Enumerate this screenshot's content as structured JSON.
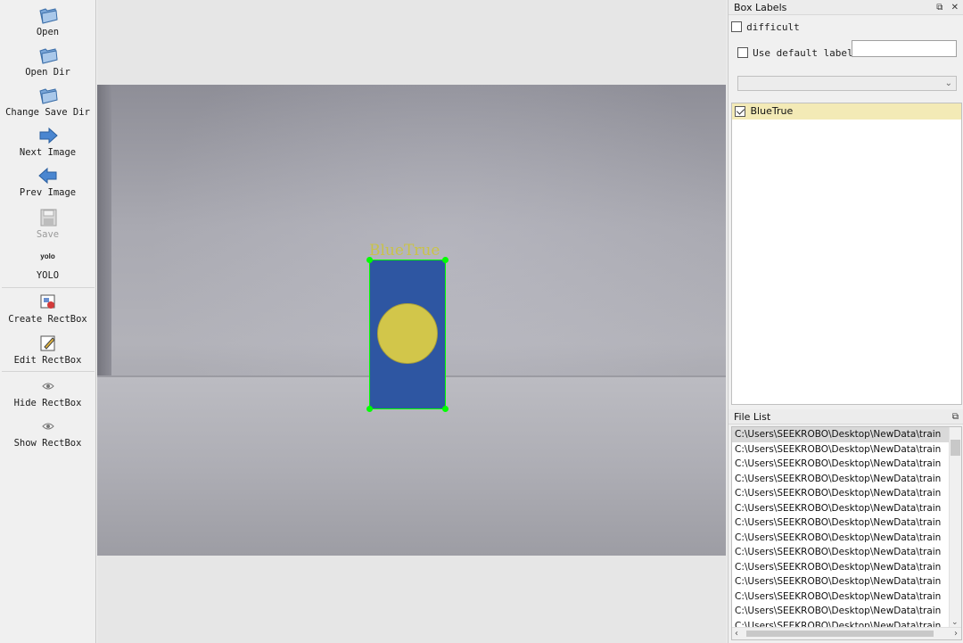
{
  "toolbar": {
    "items": [
      {
        "label": "Open",
        "icon": "folder-open-icon"
      },
      {
        "label": "Open Dir",
        "icon": "folder-open-icon"
      },
      {
        "label": "Change Save Dir",
        "icon": "folder-open-icon"
      },
      {
        "label": "Next Image",
        "icon": "arrow-right-icon"
      },
      {
        "label": "Prev Image",
        "icon": "arrow-left-icon"
      },
      {
        "label": "Save",
        "icon": "save-icon",
        "disabled": true
      },
      {
        "label": "YOLO",
        "icon_text": "yolo"
      },
      {
        "label": "Create RectBox",
        "icon": "create-rect-icon"
      },
      {
        "label": "Edit RectBox",
        "icon": "edit-rect-icon"
      },
      {
        "label": "Hide RectBox",
        "icon": "eye-icon"
      },
      {
        "label": "Show RectBox",
        "icon": "eye-icon"
      }
    ]
  },
  "canvas": {
    "bbox_label": "BlueTrue"
  },
  "box_labels_panel": {
    "title": "Box Labels",
    "difficult_label": "difficult",
    "difficult_checked": false,
    "use_default_label": "Use default label",
    "use_default_checked": false,
    "default_label_value": "",
    "dropdown_value": "",
    "labels": [
      {
        "text": "BlueTrue",
        "checked": true
      }
    ]
  },
  "file_list_panel": {
    "title": "File List",
    "files": [
      "C:\\Users\\SEEKROBO\\Desktop\\NewData\\train",
      "C:\\Users\\SEEKROBO\\Desktop\\NewData\\train",
      "C:\\Users\\SEEKROBO\\Desktop\\NewData\\train",
      "C:\\Users\\SEEKROBO\\Desktop\\NewData\\train",
      "C:\\Users\\SEEKROBO\\Desktop\\NewData\\train",
      "C:\\Users\\SEEKROBO\\Desktop\\NewData\\train",
      "C:\\Users\\SEEKROBO\\Desktop\\NewData\\train",
      "C:\\Users\\SEEKROBO\\Desktop\\NewData\\train",
      "C:\\Users\\SEEKROBO\\Desktop\\NewData\\train",
      "C:\\Users\\SEEKROBO\\Desktop\\NewData\\train",
      "C:\\Users\\SEEKROBO\\Desktop\\NewData\\train",
      "C:\\Users\\SEEKROBO\\Desktop\\NewData\\train",
      "C:\\Users\\SEEKROBO\\Desktop\\NewData\\train",
      "C:\\Users\\SEEKROBO\\Desktop\\NewData\\train"
    ]
  },
  "colors": {
    "bbox": "#00ff00",
    "selected_label_bg": "#f3eab6",
    "label_text": "#c9c34a"
  }
}
